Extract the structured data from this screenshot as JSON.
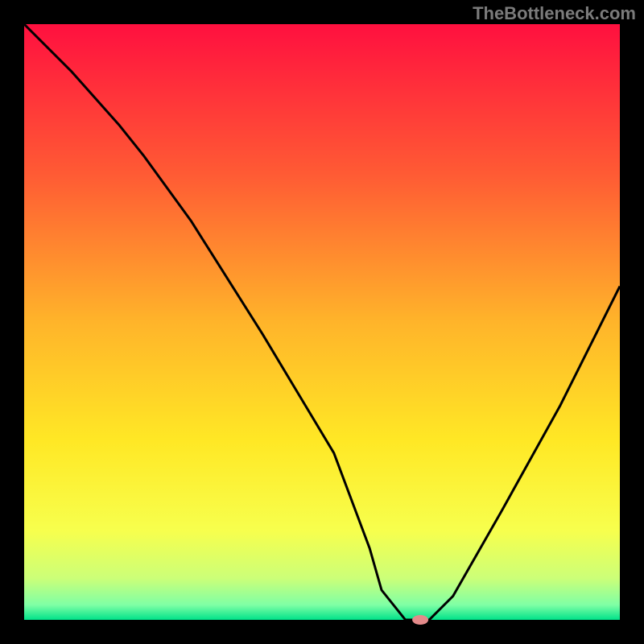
{
  "watermark": "TheBottleneck.com",
  "chart_data": {
    "type": "line",
    "title": "",
    "xlabel": "",
    "ylabel": "",
    "xlim": [
      0,
      100
    ],
    "ylim": [
      0,
      100
    ],
    "grid": false,
    "legend": false,
    "background": {
      "type": "vertical-gradient",
      "stops": [
        {
          "pos": 0.0,
          "color": "#ff103f"
        },
        {
          "pos": 0.25,
          "color": "#ff5a34"
        },
        {
          "pos": 0.5,
          "color": "#ffb42a"
        },
        {
          "pos": 0.7,
          "color": "#ffe825"
        },
        {
          "pos": 0.85,
          "color": "#f7ff4d"
        },
        {
          "pos": 0.93,
          "color": "#ccff78"
        },
        {
          "pos": 0.975,
          "color": "#7fffa5"
        },
        {
          "pos": 1.0,
          "color": "#00e28a"
        }
      ]
    },
    "series": [
      {
        "name": "bottleneck-curve",
        "color": "#000000",
        "x": [
          0,
          8,
          16,
          20,
          28,
          40,
          52,
          58,
          60,
          64,
          68,
          72,
          80,
          90,
          100
        ],
        "values": [
          100,
          92,
          83,
          78,
          67,
          48,
          28,
          12,
          5,
          0,
          0,
          4,
          18,
          36,
          56
        ]
      }
    ],
    "marker": {
      "name": "optimal-point",
      "x": 66.5,
      "y": 0,
      "color": "#e48a8a",
      "rx": 10,
      "ry": 6
    },
    "frame_color": "#000000",
    "frame_thickness": 30
  }
}
